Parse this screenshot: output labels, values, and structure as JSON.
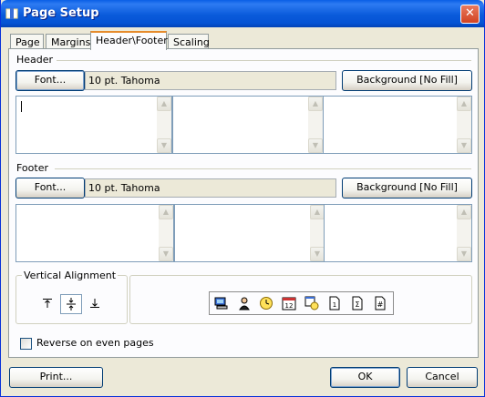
{
  "window": {
    "title": "Page Setup",
    "close_glyph": "✕",
    "title_icon": "page-setup-icon"
  },
  "tabs": [
    {
      "label": "Page",
      "active": false
    },
    {
      "label": "Margins",
      "active": false
    },
    {
      "label": "Header\\Footer",
      "active": true
    },
    {
      "label": "Scaling",
      "active": false
    }
  ],
  "header": {
    "section_label": "Header",
    "font_button": "Font...",
    "font_value": "10 pt. Tahoma",
    "background_button": "Background [No Fill]"
  },
  "footer": {
    "section_label": "Footer",
    "font_button": "Font...",
    "font_value": "10 pt. Tahoma",
    "background_button": "Background [No Fill]"
  },
  "vertical_alignment": {
    "label": "Vertical Alignment",
    "options": [
      "top",
      "center",
      "bottom"
    ],
    "selected": "center"
  },
  "insert_toolbar": {
    "icons": [
      "computer-icon",
      "user-icon",
      "clock-icon",
      "calendar-icon",
      "date-time-icon",
      "page-number-icon",
      "page-count-icon",
      "number-icon"
    ]
  },
  "reverse_option": {
    "label": "Reverse on even pages",
    "checked": false
  },
  "buttons": {
    "print": "Print...",
    "ok": "OK",
    "cancel": "Cancel"
  },
  "colors": {
    "titlebar": "#0A5BDB",
    "dialog_bg": "#ECE9D8",
    "active_tab_accent": "#E68B2C",
    "close_button": "#D24322"
  }
}
